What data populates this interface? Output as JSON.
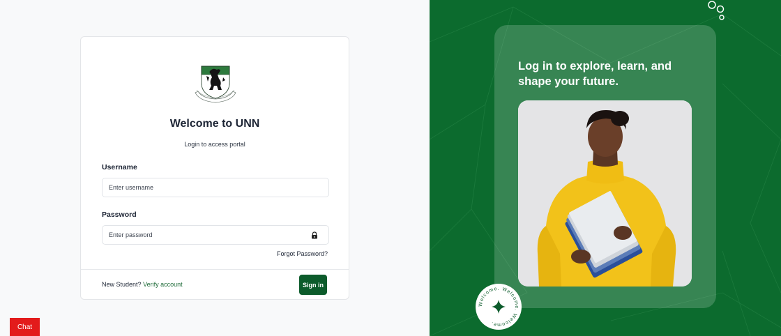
{
  "login": {
    "title": "Welcome to UNN",
    "subtitle": "Login to access portal",
    "username_label": "Username",
    "username_placeholder": "Enter username",
    "password_label": "Password",
    "password_placeholder": "Enter password",
    "forgot_password": "Forgot Password?",
    "new_student_text": "New Student?",
    "verify_link": "Verify account",
    "signin_button": "Sign in"
  },
  "chat": {
    "label": "Chat"
  },
  "hero": {
    "tagline": "Log in to explore, learn, and shape your future.",
    "badge_text": "Welcome. Welcome. Welcome."
  },
  "icons": {
    "logo": "unn-crest-logo",
    "password": "lock-icon",
    "badge": "sparkle-star-icon",
    "decor": "bubbles-icon"
  },
  "colors": {
    "brand_green": "#0c6b2e",
    "button_green": "#0c5b2b",
    "link_green": "#1e6b38",
    "chat_red": "#e31b1b",
    "text_dark": "#1c2434"
  }
}
